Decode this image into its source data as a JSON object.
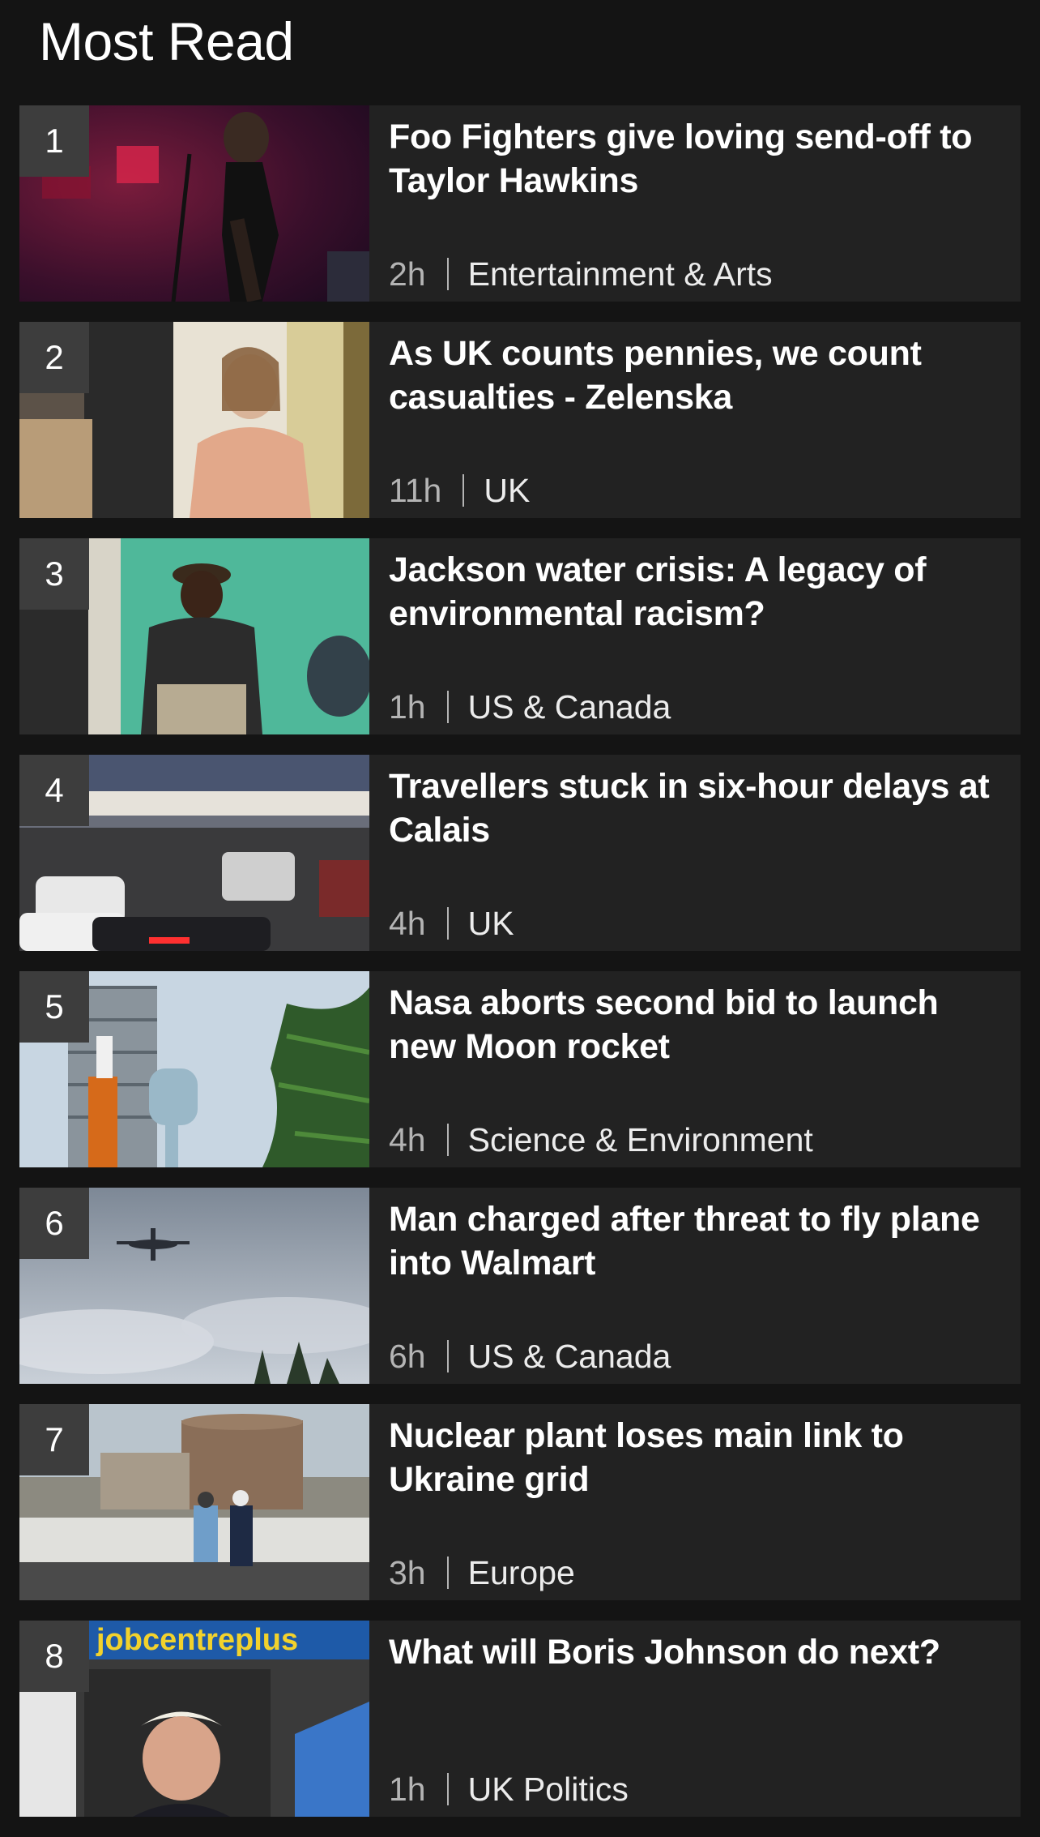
{
  "header": {
    "title": "Most Read"
  },
  "items": [
    {
      "rank": "1",
      "title": "Foo Fighters give loving send-off to Taylor Hawkins",
      "time": "2h",
      "section": "Entertainment & Arts"
    },
    {
      "rank": "2",
      "title": "As UK counts pennies, we count casualties - Zelenska",
      "time": "11h",
      "section": "UK"
    },
    {
      "rank": "3",
      "title": "Jackson water crisis: A legacy of environmental racism?",
      "time": "1h",
      "section": "US & Canada"
    },
    {
      "rank": "4",
      "title": "Travellers stuck in six-hour delays at Calais",
      "time": "4h",
      "section": "UK"
    },
    {
      "rank": "5",
      "title": "Nasa aborts second bid to launch new Moon rocket",
      "time": "4h",
      "section": "Science & Environment"
    },
    {
      "rank": "6",
      "title": "Man charged after threat to fly plane into Walmart",
      "time": "6h",
      "section": "US & Canada"
    },
    {
      "rank": "7",
      "title": "Nuclear plant loses main link to Ukraine grid",
      "time": "3h",
      "section": "Europe"
    },
    {
      "rank": "8",
      "title": "What will Boris Johnson do next?",
      "time": "1h",
      "section": "UK Politics",
      "image_text": "jobcentreplus"
    }
  ],
  "colors": {
    "background": "#141414",
    "card": "#222222",
    "rank_badge": "#3d3d3d",
    "meta_time": "#b4b4b4"
  }
}
